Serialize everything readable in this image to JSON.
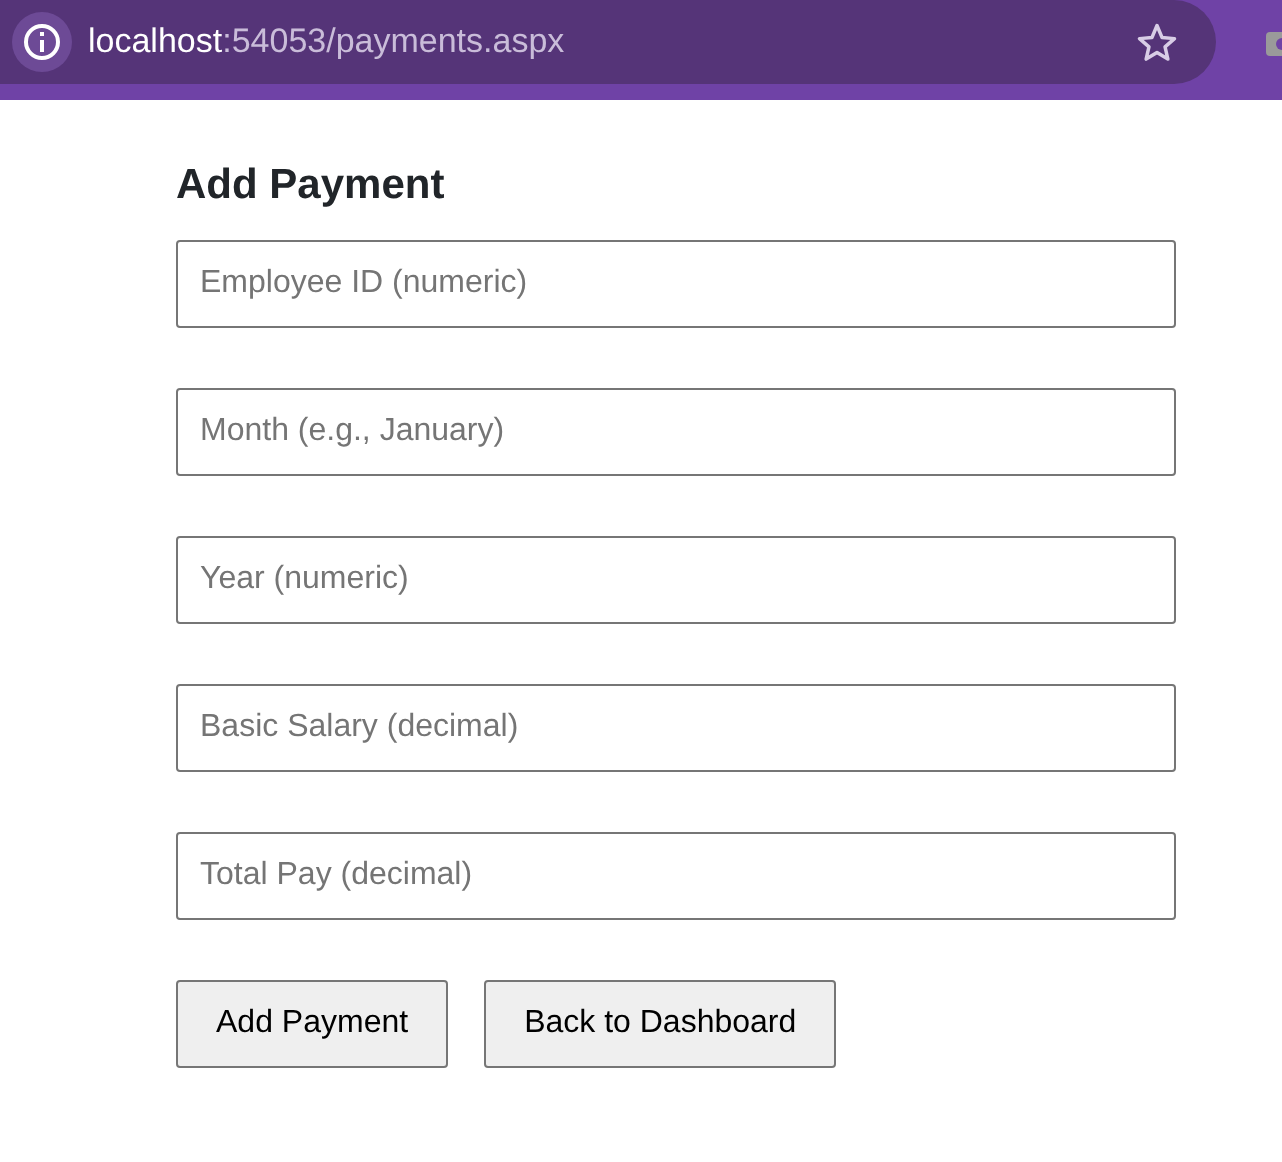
{
  "address_bar": {
    "host": "localhost",
    "path": ":54053/payments.aspx"
  },
  "form": {
    "title": "Add Payment",
    "fields": [
      {
        "placeholder": "Employee ID (numeric)"
      },
      {
        "placeholder": "Month (e.g., January)"
      },
      {
        "placeholder": "Year (numeric)"
      },
      {
        "placeholder": "Basic Salary (decimal)"
      },
      {
        "placeholder": "Total Pay (decimal)"
      }
    ],
    "buttons": [
      {
        "label": "Add Payment"
      },
      {
        "label": "Back to Dashboard"
      }
    ]
  }
}
